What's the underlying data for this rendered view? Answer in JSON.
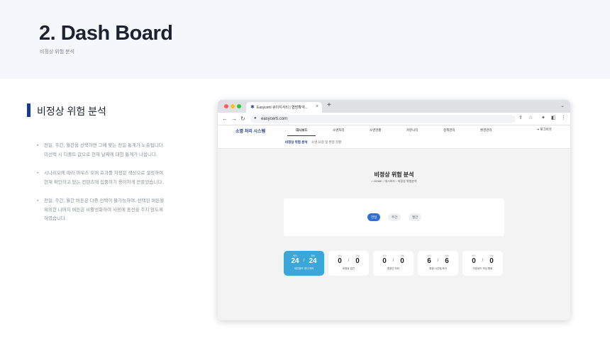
{
  "slide": {
    "title": "2. Dash Board",
    "subtitle": "비정상 위험 분석",
    "section_title": "비정상 위험 분석",
    "bullet_marker": "•",
    "bullets": [
      {
        "line1": "전일, 주간, 월간을 선택하면 그에 맞는 전일 통계가 노출됩니다.",
        "line2": "미선택 시 디폴트 값으로 현재 날짜에 대한 통계가 나옵니다."
      },
      {
        "line1": "시나리오에 따라 마우스 오버 효과를 지정된 색상으로 설정하여",
        "line2": "현재 확인하고 있는 컨텐츠에 집중하기 용이하게 만들었습니다."
      },
      {
        "line1": "전일, 주간, 월간 버튼은 다중 선택이 불가능하며, 선택된 버튼을",
        "line2": "제외한 나머지 버튼은 비활성화하여 사용에 혼선을 주지 않도록",
        "line3": "하였습니다."
      }
    ]
  },
  "browser": {
    "tab_title": "Easycerti 큐이지서티 | 협방확약...",
    "tab_close": "×",
    "new_tab": "+",
    "tab_menu": "⌄",
    "url": "easycerti.com",
    "nav": {
      "back": "←",
      "forward": "→",
      "reload": "↻"
    },
    "icons": {
      "share": "⇪",
      "star": "☆",
      "ext": "✦",
      "sidebar": "◧",
      "more": "⋮",
      "lock": "●"
    }
  },
  "site": {
    "logo": "소명 처리 시스템",
    "menu": [
      "대시보드",
      "소명처리",
      "소명현황",
      "커뮤니티",
      "정책관리",
      "환경관리"
    ],
    "active_menu": "대시보드",
    "logout": "⇥ 로그아웃",
    "subnav": [
      "비정상 위험 분석",
      "소명 요청 및 완정 현황"
    ],
    "page_title": "비정상 위험 분석",
    "breadcrumb": "⌂ HOME  ›  대시보드  ›  비정상 위험분석",
    "filters": [
      "전일",
      "주간",
      "월간"
    ],
    "active_filter": "전일",
    "stats": [
      {
        "small_left": "처리",
        "small_right": "전체",
        "left": "24",
        "right": "24",
        "label": "개인정보 과다 처리",
        "active": true
      },
      {
        "small_left": "처리",
        "small_right": "전체",
        "left": "0",
        "right": "0",
        "label": "비정상 접근",
        "active": false
      },
      {
        "small_left": "처리",
        "small_right": "전체",
        "left": "0",
        "right": "0",
        "label": "특정인 처리",
        "active": false
      },
      {
        "small_left": "처리",
        "small_right": "전체",
        "left": "6",
        "right": "6",
        "label": "특정 시간대 처리",
        "active": false
      },
      {
        "small_left": "처리",
        "small_right": "전체",
        "left": "0",
        "right": "0",
        "label": "다운로드 의심 행위",
        "active": false
      }
    ],
    "stat_divider": "/"
  },
  "colors": {
    "accent": "#1b3a8c",
    "active_stat": "#3ca6d8",
    "active_pill": "#2c6fd8",
    "hero_bg": "#f4f7fc"
  }
}
